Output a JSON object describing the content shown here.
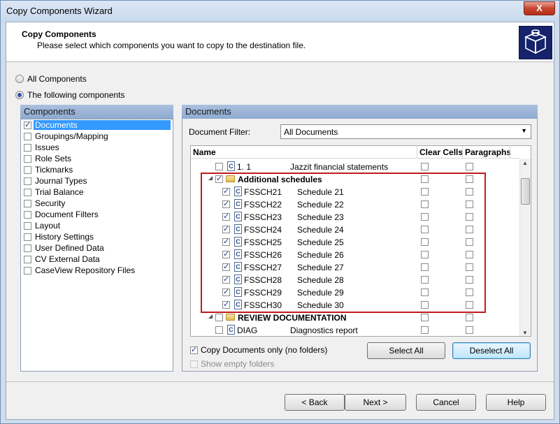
{
  "window": {
    "title": "Copy Components Wizard",
    "close_glyph": "X"
  },
  "header": {
    "title": "Copy Components",
    "subtitle": "Please select which components you want to copy to the destination file."
  },
  "options": {
    "all_components": "All Components",
    "following_components": "The following components",
    "selected": "following_components"
  },
  "components_panel": {
    "title": "Components",
    "items": [
      {
        "label": "Documents",
        "checked": true,
        "selected": true
      },
      {
        "label": "Groupings/Mapping",
        "checked": false
      },
      {
        "label": "Issues",
        "checked": false
      },
      {
        "label": "Role Sets",
        "checked": false
      },
      {
        "label": "Tickmarks",
        "checked": false
      },
      {
        "label": "Journal Types",
        "checked": false
      },
      {
        "label": "Trial Balance",
        "checked": false
      },
      {
        "label": "Security",
        "checked": false
      },
      {
        "label": "Document Filters",
        "checked": false
      },
      {
        "label": "Layout",
        "checked": false
      },
      {
        "label": "History Settings",
        "checked": false
      },
      {
        "label": "User Defined Data",
        "checked": false
      },
      {
        "label": "CV External Data",
        "checked": false
      },
      {
        "label": "CaseView Repository Files",
        "checked": false
      }
    ]
  },
  "documents_panel": {
    "title": "Documents",
    "filter_label": "Document Filter:",
    "filter_value": "All Documents",
    "columns": {
      "name": "Name",
      "clear_cells": "Clear Cells",
      "paragraphs": "Paragraphs"
    },
    "rows": [
      {
        "kind": "doc",
        "id": "1. 1",
        "desc": "Jazzit financial statements",
        "checked": false,
        "indent": 1
      },
      {
        "kind": "folder",
        "id": "Additional schedules",
        "checked": true,
        "expanded": true,
        "indent": 0
      },
      {
        "kind": "doc",
        "id": "FSSCH21",
        "desc": "Schedule 21",
        "checked": true,
        "indent": 2
      },
      {
        "kind": "doc",
        "id": "FSSCH22",
        "desc": "Schedule 22",
        "checked": true,
        "indent": 2
      },
      {
        "kind": "doc",
        "id": "FSSCH23",
        "desc": "Schedule 23",
        "checked": true,
        "indent": 2
      },
      {
        "kind": "doc",
        "id": "FSSCH24",
        "desc": "Schedule 24",
        "checked": true,
        "indent": 2
      },
      {
        "kind": "doc",
        "id": "FSSCH25",
        "desc": "Schedule 25",
        "checked": true,
        "indent": 2
      },
      {
        "kind": "doc",
        "id": "FSSCH26",
        "desc": "Schedule 26",
        "checked": true,
        "indent": 2
      },
      {
        "kind": "doc",
        "id": "FSSCH27",
        "desc": "Schedule 27",
        "checked": true,
        "indent": 2
      },
      {
        "kind": "doc",
        "id": "FSSCH28",
        "desc": "Schedule 28",
        "checked": true,
        "indent": 2
      },
      {
        "kind": "doc",
        "id": "FSSCH29",
        "desc": "Schedule 29",
        "checked": true,
        "indent": 2
      },
      {
        "kind": "doc",
        "id": "FSSCH30",
        "desc": "Schedule 30",
        "checked": true,
        "indent": 2
      },
      {
        "kind": "folder",
        "id": "REVIEW DOCUMENTATION",
        "checked": false,
        "expanded": true,
        "indent": 0
      },
      {
        "kind": "doc",
        "id": "DIAG",
        "desc": "Diagnostics report",
        "checked": false,
        "indent": 1
      }
    ],
    "copy_docs_only": "Copy Documents only (no folders)",
    "show_empty_folders": "Show empty folders",
    "select_all": "Select All",
    "deselect_all": "Deselect All"
  },
  "footer": {
    "back": "< Back",
    "next": "Next >",
    "cancel": "Cancel",
    "help": "Help"
  },
  "icons": {
    "doc_glyph": "C",
    "up_arrow": "▲",
    "down_arrow": "▼",
    "expander": "◢",
    "dropdown": "▼"
  },
  "colors": {
    "highlight_border": "#c21b1b",
    "selection": "#3399ff",
    "panel_header": "#a9c0de",
    "logo": "#16236b"
  }
}
